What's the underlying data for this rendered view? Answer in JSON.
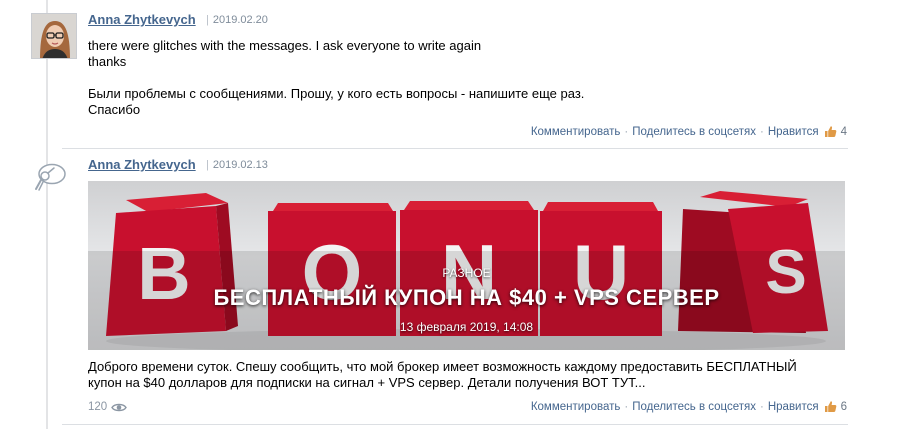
{
  "posts": [
    {
      "author": "Anna Zhytkevych",
      "date": "2019.02.20",
      "lines": [
        "there were glitches with the messages. I ask everyone to write again",
        "thanks",
        "",
        "Были проблемы с сообщениями. Прошу, у кого есть вопросы - напишите еще раз.",
        "Спасибо"
      ],
      "actions": {
        "comment": "Комментировать",
        "share": "Поделитесь в соцсетях",
        "like": "Нравится",
        "like_count": "4"
      }
    },
    {
      "author": "Anna Zhytkevych",
      "date": "2019.02.13",
      "banner": {
        "category": "РАЗНОЕ",
        "title": "БЕСПЛАТНЫЙ КУПОН НА $40 + VPS СЕРВЕР",
        "date": "13 февраля 2019, 14:08",
        "letters": [
          "B",
          "O",
          "N",
          "U",
          "S"
        ],
        "colors": {
          "cube_front": "#c8102e",
          "cube_side": "#9e0b22",
          "letter": "#f4f4f4"
        }
      },
      "lines": [
        "Доброго времени суток. Спешу сообщить, что мой брокер имеет возможность каждому предоставить БЕСПЛАТНЫЙ",
        "купон на $40 долларов для подписки на сигнал + VPS сервер. Детали получения ВОТ ТУТ..."
      ],
      "views": "120",
      "actions": {
        "comment": "Комментировать",
        "share": "Поделитесь в соцсетях",
        "like": "Нравится",
        "like_count": "6"
      }
    }
  ],
  "icons": {
    "separator": "·",
    "like": "thumbs-up-icon",
    "views": "eye-icon",
    "feed": "satellite-dish-icon"
  },
  "colors": {
    "link": "#45668e",
    "muted": "#7f8c9a",
    "like_icon": "#e09a46"
  }
}
